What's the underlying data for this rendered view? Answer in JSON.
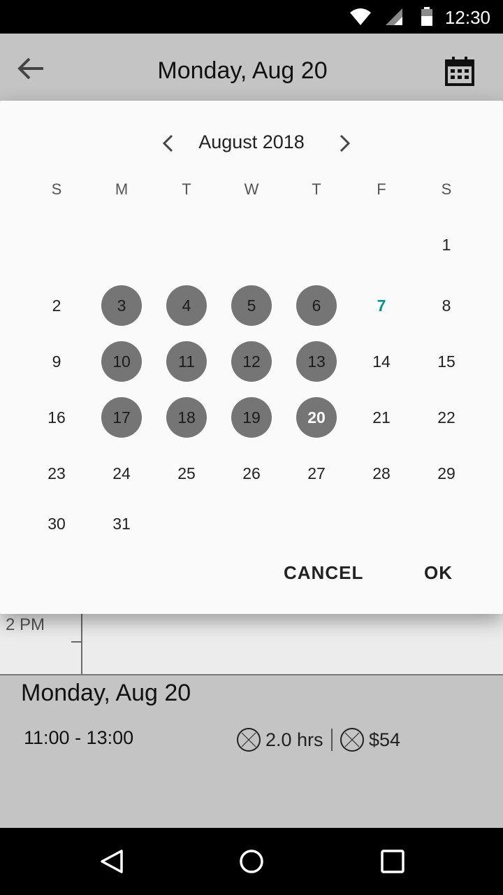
{
  "status_bar": {
    "time": "12:30",
    "icons": [
      "wifi-icon",
      "signal-icon",
      "battery-icon"
    ]
  },
  "app_bar": {
    "back_icon": "arrow-back-icon",
    "title": "Monday, Aug 20",
    "calendar_icon": "calendar-icon"
  },
  "timeline": {
    "hour_label": "2 PM"
  },
  "summary": {
    "title": "Monday, Aug 20",
    "time_range": "11:00 - 13:00",
    "duration": "2.0 hrs",
    "price": "$54"
  },
  "date_picker": {
    "month_label": "August 2018",
    "weekdays": [
      "S",
      "M",
      "T",
      "W",
      "T",
      "F",
      "S"
    ],
    "days": [
      {
        "label": "1"
      },
      {
        "label": "2"
      },
      {
        "label": "3"
      },
      {
        "label": "4"
      },
      {
        "label": "5"
      },
      {
        "label": "6"
      },
      {
        "label": "7"
      },
      {
        "label": "8"
      },
      {
        "label": "9"
      },
      {
        "label": "10"
      },
      {
        "label": "11"
      },
      {
        "label": "12"
      },
      {
        "label": "13"
      },
      {
        "label": "14"
      },
      {
        "label": "15"
      },
      {
        "label": "16"
      },
      {
        "label": "17"
      },
      {
        "label": "18"
      },
      {
        "label": "19"
      },
      {
        "label": "20"
      },
      {
        "label": "21"
      },
      {
        "label": "22"
      },
      {
        "label": "23"
      },
      {
        "label": "24"
      },
      {
        "label": "25"
      },
      {
        "label": "26"
      },
      {
        "label": "27"
      },
      {
        "label": "28"
      },
      {
        "label": "29"
      },
      {
        "label": "30"
      },
      {
        "label": "31"
      }
    ],
    "highlighted_days": [
      3,
      4,
      5,
      6,
      10,
      11,
      12,
      13,
      17,
      18,
      19
    ],
    "selected_day": 20,
    "today_day": 7,
    "today_color": "#009688",
    "cancel_label": "CANCEL",
    "ok_label": "OK"
  },
  "nav_bar": {
    "icons": [
      "back-triangle-icon",
      "home-circle-icon",
      "recents-square-icon"
    ]
  }
}
